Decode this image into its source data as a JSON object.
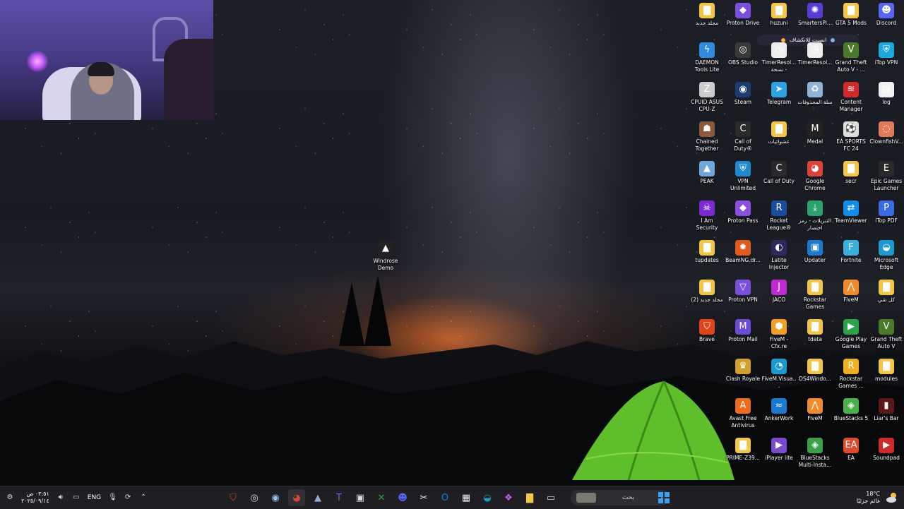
{
  "webcam": {
    "label": "webcam-overlay"
  },
  "pill": {
    "text": "انصبت للانكشاف"
  },
  "solo_icon": {
    "label": "Windrose Demo",
    "glyph": "▲"
  },
  "icons": [
    {
      "label": "مجلد جديد",
      "glyph": "▇",
      "color": "#f4c542",
      "col": 0,
      "row": 0
    },
    {
      "label": "Proton Drive",
      "glyph": "◆",
      "color": "#7b4fe0",
      "col": 1,
      "row": 0
    },
    {
      "label": "huzuni",
      "glyph": "▇",
      "color": "#f4c542",
      "col": 2,
      "row": 0
    },
    {
      "label": "SmartersPl...",
      "glyph": "✺",
      "color": "#5b3ad6",
      "col": 3,
      "row": 0
    },
    {
      "label": "GTA 5 Mods",
      "glyph": "▇",
      "color": "#f4c542",
      "col": 4,
      "row": 0
    },
    {
      "label": "Discord",
      "glyph": "☻",
      "color": "#5865f2",
      "col": 5,
      "row": 0
    },
    {
      "label": "DAEMON Tools Lite",
      "glyph": "ϟ",
      "color": "#2f8be0",
      "col": 0,
      "row": 1
    },
    {
      "label": "OBS Studio",
      "glyph": "◎",
      "color": "#3a3a3a",
      "col": 1,
      "row": 1
    },
    {
      "label": "TimerResol... نسخة -",
      "glyph": "◷",
      "color": "#eeeeee",
      "col": 2,
      "row": 1
    },
    {
      "label": "TimerResol...",
      "glyph": "◷",
      "color": "#eeeeee",
      "col": 3,
      "row": 1
    },
    {
      "label": "Grand Theft Auto V - ...",
      "glyph": "V",
      "color": "#4a7a2a",
      "col": 4,
      "row": 1
    },
    {
      "label": "iTop VPN",
      "glyph": "⛨",
      "color": "#1ba8e0",
      "col": 5,
      "row": 1
    },
    {
      "label": "CPUID ASUS CPU-Z",
      "glyph": "Z",
      "color": "#cccccc",
      "col": 0,
      "row": 2
    },
    {
      "label": "Steam",
      "glyph": "◉",
      "color": "#1b3c6e",
      "col": 1,
      "row": 2
    },
    {
      "label": "Telegram",
      "glyph": "➤",
      "color": "#2aa3e0",
      "col": 2,
      "row": 2
    },
    {
      "label": "سلة المحذوفات",
      "glyph": "♻",
      "color": "#8fb4d8",
      "col": 3,
      "row": 2
    },
    {
      "label": "Content Manager",
      "glyph": "≋",
      "color": "#d22a2a",
      "col": 4,
      "row": 2
    },
    {
      "label": "log",
      "glyph": "▤",
      "color": "#f0f0f0",
      "col": 5,
      "row": 2
    },
    {
      "label": "Chained Together",
      "glyph": "☗",
      "color": "#8a5a3a",
      "col": 0,
      "row": 3
    },
    {
      "label": "Call of Duty®",
      "glyph": "C",
      "color": "#2a2a2a",
      "col": 1,
      "row": 3
    },
    {
      "label": "عشوائيات",
      "glyph": "▇",
      "color": "#f4c542",
      "col": 2,
      "row": 3
    },
    {
      "label": "Medal",
      "glyph": "M",
      "color": "#222222",
      "col": 3,
      "row": 3
    },
    {
      "label": "EA SPORTS FC 24",
      "glyph": "⚽",
      "color": "#dddddd",
      "col": 4,
      "row": 3
    },
    {
      "label": "ClownfishV...",
      "glyph": "◌",
      "color": "#e07a5a",
      "col": 5,
      "row": 3
    },
    {
      "label": "PEAK",
      "glyph": "▲",
      "color": "#6fa7d8",
      "col": 0,
      "row": 4
    },
    {
      "label": "VPN Unlimited",
      "glyph": "⛨",
      "color": "#1f8ad0",
      "col": 1,
      "row": 4
    },
    {
      "label": "Call of Duty",
      "glyph": "C",
      "color": "#2a2a2a",
      "col": 2,
      "row": 4
    },
    {
      "label": "Google Chrome",
      "glyph": "◕",
      "color": "#db4437",
      "col": 3,
      "row": 4
    },
    {
      "label": "secr",
      "glyph": "▇",
      "color": "#f4c542",
      "col": 4,
      "row": 4
    },
    {
      "label": "Epic Games Launcher",
      "glyph": "E",
      "color": "#2a2a2a",
      "col": 5,
      "row": 4
    },
    {
      "label": "I Am Security",
      "glyph": "☠",
      "color": "#7a2ad0",
      "col": 0,
      "row": 5
    },
    {
      "label": "Proton Pass",
      "glyph": "◆",
      "color": "#8a4fe0",
      "col": 1,
      "row": 5
    },
    {
      "label": "Rocket League®",
      "glyph": "R",
      "color": "#1a4ca0",
      "col": 2,
      "row": 5
    },
    {
      "label": "التنزيلات - رمز اختصار",
      "glyph": "⤓",
      "color": "#2aa36a",
      "col": 3,
      "row": 5
    },
    {
      "label": "TeamViewer",
      "glyph": "⇄",
      "color": "#0e8ee9",
      "col": 4,
      "row": 5
    },
    {
      "label": "iTop PDF",
      "glyph": "P",
      "color": "#3a6ae0",
      "col": 5,
      "row": 5
    },
    {
      "label": "tupdates",
      "glyph": "▇",
      "color": "#f4c542",
      "col": 0,
      "row": 6
    },
    {
      "label": "BeamNG.dr...",
      "glyph": "✹",
      "color": "#e05a1a",
      "col": 1,
      "row": 6
    },
    {
      "label": "Latite Injector",
      "glyph": "◐",
      "color": "#2a2a5a",
      "col": 2,
      "row": 6
    },
    {
      "label": "Updater",
      "glyph": "▣",
      "color": "#1a7ad0",
      "col": 3,
      "row": 6
    },
    {
      "label": "Fortnite",
      "glyph": "F",
      "color": "#3ab0e0",
      "col": 4,
      "row": 6
    },
    {
      "label": "Microsoft Edge",
      "glyph": "◒",
      "color": "#1a9ad0",
      "col": 5,
      "row": 6
    },
    {
      "label": "مجلد جديد (2)",
      "glyph": "▇",
      "color": "#f4c542",
      "col": 0,
      "row": 7
    },
    {
      "label": "Proton VPN",
      "glyph": "▽",
      "color": "#7a4fe0",
      "col": 1,
      "row": 7
    },
    {
      "label": "JACO",
      "glyph": "J",
      "color": "#c02ad0",
      "col": 2,
      "row": 7
    },
    {
      "label": "Rockstar Games",
      "glyph": "▇",
      "color": "#f4c542",
      "col": 3,
      "row": 7
    },
    {
      "label": "FiveM",
      "glyph": "⋀",
      "color": "#f08a2a",
      "col": 4,
      "row": 7
    },
    {
      "label": "كل شي",
      "glyph": "▇",
      "color": "#f4c542",
      "col": 5,
      "row": 7
    },
    {
      "label": "Brave",
      "glyph": "⛉",
      "color": "#e0451a",
      "col": 0,
      "row": 8
    },
    {
      "label": "Proton Mail",
      "glyph": "M",
      "color": "#6d4ad8",
      "col": 1,
      "row": 8
    },
    {
      "label": "FiveM - Cfx.re Devel...",
      "glyph": "⬢",
      "color": "#f0a020",
      "col": 2,
      "row": 8
    },
    {
      "label": "tdata",
      "glyph": "▇",
      "color": "#f4c542",
      "col": 3,
      "row": 8
    },
    {
      "label": "Google Play Games",
      "glyph": "▶",
      "color": "#2aa34a",
      "col": 4,
      "row": 8
    },
    {
      "label": "Grand Theft Auto V",
      "glyph": "V",
      "color": "#4a7a2a",
      "col": 5,
      "row": 8
    },
    {
      "label": "Clash Royale",
      "glyph": "♛",
      "color": "#d0a02a",
      "col": 1,
      "row": 9
    },
    {
      "label": "FiveM.Visua...",
      "glyph": "◔",
      "color": "#1a9ad0",
      "col": 2,
      "row": 9
    },
    {
      "label": "DS4Windo...",
      "glyph": "▇",
      "color": "#f4c542",
      "col": 3,
      "row": 9
    },
    {
      "label": "Rockstar Games ...",
      "glyph": "R",
      "color": "#f0b020",
      "col": 4,
      "row": 9
    },
    {
      "label": "modules",
      "glyph": "▇",
      "color": "#f4c542",
      "col": 5,
      "row": 9
    },
    {
      "label": "Avast Free Antivirus",
      "glyph": "A",
      "color": "#f06a1a",
      "col": 1,
      "row": 10
    },
    {
      "label": "AnkerWork",
      "glyph": "≈",
      "color": "#1a7ad0",
      "col": 2,
      "row": 10
    },
    {
      "label": "FiveM",
      "glyph": "⋀",
      "color": "#f08a2a",
      "col": 3,
      "row": 10
    },
    {
      "label": "BlueStacks 5",
      "glyph": "◈",
      "color": "#4ab04a",
      "col": 4,
      "row": 10
    },
    {
      "label": "Liar's Bar",
      "glyph": "▮",
      "color": "#5a1a1a",
      "col": 5,
      "row": 10
    },
    {
      "label": "PRIME-Z39...",
      "glyph": "▇",
      "color": "#f4c542",
      "col": 1,
      "row": 11
    },
    {
      "label": "iPlayer lite",
      "glyph": "▶",
      "color": "#7a4ad0",
      "col": 2,
      "row": 11
    },
    {
      "label": "BlueStacks Multi-Insta...",
      "glyph": "◈",
      "color": "#3aa04a",
      "col": 3,
      "row": 11
    },
    {
      "label": "EA",
      "glyph": "EA",
      "color": "#e04a2a",
      "col": 4,
      "row": 11
    },
    {
      "label": "Soundpad",
      "glyph": "▶",
      "color": "#d02a2a",
      "col": 5,
      "row": 11
    }
  ],
  "taskbar": {
    "time": "٠٣:٥١ ص",
    "date": "٢٠٢٥/٠٩/١٤",
    "language": "ENG",
    "search_placeholder": "بحث",
    "weather_temp": "18°C",
    "weather_desc": "غائم جزئيًا",
    "apps": [
      {
        "name": "brave",
        "glyph": "⛉",
        "color": "#e0451a"
      },
      {
        "name": "obs",
        "glyph": "◎",
        "color": "#dddddd"
      },
      {
        "name": "steam",
        "glyph": "◉",
        "color": "#9ac0f0"
      },
      {
        "name": "chrome",
        "glyph": "◕",
        "color": "#db4437",
        "active": true
      },
      {
        "name": "app5",
        "glyph": "▲",
        "color": "#8ab0d8"
      },
      {
        "name": "teams",
        "glyph": "T",
        "color": "#6a6ae0"
      },
      {
        "name": "app7",
        "glyph": "▣",
        "color": "#dddddd"
      },
      {
        "name": "xbox",
        "glyph": "✕",
        "color": "#2aa34a"
      },
      {
        "name": "discord",
        "glyph": "☻",
        "color": "#5865f2"
      },
      {
        "name": "capcut",
        "glyph": "✂",
        "color": "#eeeeee"
      },
      {
        "name": "outlook",
        "glyph": "O",
        "color": "#1a7ad0"
      },
      {
        "name": "store",
        "glyph": "▦",
        "color": "#eeeeee"
      },
      {
        "name": "edge",
        "glyph": "◒",
        "color": "#1a9ad0"
      },
      {
        "name": "copilot",
        "glyph": "❖",
        "color": "#c06ae0"
      },
      {
        "name": "explorer",
        "glyph": "▇",
        "color": "#f4c542"
      },
      {
        "name": "app16",
        "glyph": "▭",
        "color": "#cccccc"
      }
    ]
  }
}
